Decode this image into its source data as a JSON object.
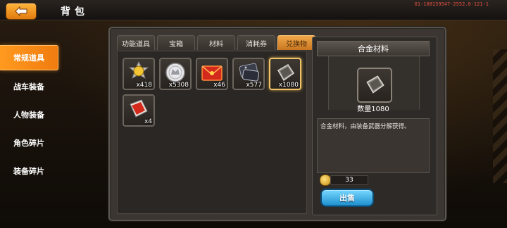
{
  "header": {
    "title": "背包",
    "debug_id": "01-108159547-2552.0-121-1",
    "back_icon": "back-arrow-icon"
  },
  "sidebar": {
    "items": [
      {
        "label": "常规道具",
        "active": true
      },
      {
        "label": "战车装备",
        "active": false
      },
      {
        "label": "人物装备",
        "active": false
      },
      {
        "label": "角色碎片",
        "active": false
      },
      {
        "label": "装备碎片",
        "active": false
      }
    ]
  },
  "tabs": [
    {
      "label": "功能道具",
      "active": false
    },
    {
      "label": "宝箱",
      "active": false
    },
    {
      "label": "材料",
      "active": false
    },
    {
      "label": "消耗券",
      "active": false
    },
    {
      "label": "兑换物",
      "active": true
    }
  ],
  "items": [
    {
      "icon": "gold-medal-icon",
      "qty": "x418",
      "selected": false
    },
    {
      "icon": "silver-coin-icon",
      "qty": "x5308",
      "selected": false
    },
    {
      "icon": "red-envelope-icon",
      "qty": "x46",
      "selected": false
    },
    {
      "icon": "dog-tag-icon",
      "qty": "x577",
      "selected": false
    },
    {
      "icon": "alloy-plate-icon",
      "qty": "x1080",
      "selected": true
    },
    {
      "icon": "red-card-icon",
      "qty": "x4",
      "selected": false
    }
  ],
  "detail": {
    "name": "合金材料",
    "icon": "alloy-plate-icon",
    "count_label": "数量1080",
    "description": "合金材料，由装备武器分解获得。",
    "price": "33",
    "price_icon": "gold-coin-icon",
    "sell_label": "出售"
  },
  "colors": {
    "accent_orange": "#f08a1a",
    "sell_blue": "#1e8fcf",
    "selected_gold": "#f2c46a"
  }
}
